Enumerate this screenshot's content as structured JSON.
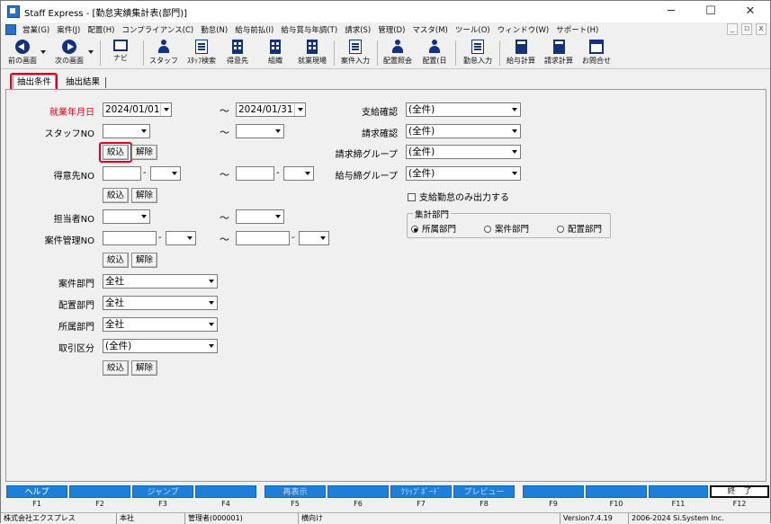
{
  "window": {
    "title": "Staff Express - [勤怠実績集計表(部門)]",
    "controls": {
      "minimize": "─",
      "maximize": "☐",
      "close": "✕"
    }
  },
  "menu": {
    "items": [
      "営業(G)",
      "案件(J)",
      "配置(H)",
      "コンプライアンス(C)",
      "勤怠(N)",
      "給与前払(I)",
      "給与賞与年調(T)",
      "請求(S)",
      "管理(D)",
      "マスタ(M)",
      "ツール(O)",
      "ウィンドウ(W)",
      "サポート(H)"
    ],
    "mdi_controls": [
      "_",
      "▫",
      "x"
    ]
  },
  "toolbar": {
    "back": "前の画面",
    "next": "次の画面",
    "navi": "ナビ",
    "staff": "スタッフ",
    "staff_search": "ｽﾀｯﾌ検索",
    "tokuisaki": "得意先",
    "soshiki": "組織",
    "shugyo_genba": "就業現場",
    "anken_nyuryoku": "案件入力",
    "haichi_shokai": "配置照会",
    "haichi_hi": "配置(日",
    "kintai_nyuryoku": "勤怠入力",
    "kyuyo_keisan": "給与計算",
    "seikyu_keisan": "請求計算",
    "otoiawase": "お問合せ"
  },
  "tabs": {
    "conditions": "抽出条件",
    "results": "抽出結果"
  },
  "form": {
    "work_ym_label": "就業年月日",
    "date_from": "2024/01/01",
    "date_to": "2024/01/31",
    "tilde": "～",
    "staff_no_label": "スタッフNO",
    "tokuisaki_no_label": "得意先NO",
    "tanto_no_label": "担当者NO",
    "anken_kanri_no_label": "案件管理NO",
    "dash": "-",
    "filter_button": "絞込",
    "clear_button": "解除",
    "anken_bumon_label": "案件部門",
    "anken_bumon_value": "全社",
    "haichi_bumon_label": "配置部門",
    "haichi_bumon_value": "全社",
    "shozoku_bumon_label": "所属部門",
    "shozoku_bumon_value": "全社",
    "torihiki_kubun_label": "取引区分",
    "torihiki_kubun_value": "(全件)",
    "shikyu_kakunin_label": "支給確認",
    "shikyu_kakunin_value": "(全件)",
    "seikyu_kakunin_label": "請求確認",
    "seikyu_kakunin_value": "(全件)",
    "seikyu_shime_label": "請求締グループ",
    "seikyu_shime_value": "(全件)",
    "kyuyo_shime_label": "給与締グループ",
    "kyuyo_shime_value": "(全件)",
    "shikyu_only_label": "支給勤怠のみ出力する",
    "shukei_bumon_title": "集計部門",
    "radio_shozoku": "所属部門",
    "radio_anken": "案件部門",
    "radio_haichi": "配置部門"
  },
  "fkeys": [
    {
      "label": "ヘルプ",
      "code": "F1",
      "enabled": true
    },
    {
      "label": "",
      "code": "F2",
      "enabled": true
    },
    {
      "label": "ジャンプ",
      "code": "F3",
      "enabled": false
    },
    {
      "label": "",
      "code": "F4",
      "enabled": true
    },
    {
      "label": "再表示",
      "code": "F5",
      "enabled": false
    },
    {
      "label": "",
      "code": "F6",
      "enabled": true
    },
    {
      "label": "ｸﾘｯﾌﾟﾎﾞｰﾄﾞ",
      "code": "F7",
      "enabled": false
    },
    {
      "label": "プレビュー",
      "code": "F8",
      "enabled": false
    },
    {
      "label": "",
      "code": "F9",
      "enabled": true
    },
    {
      "label": "",
      "code": "F10",
      "enabled": true
    },
    {
      "label": "",
      "code": "F11",
      "enabled": true
    },
    {
      "label": "終　了",
      "code": "F12",
      "enabled": true
    }
  ],
  "status": {
    "company": "株式会社エクスプレス",
    "branch": "本社",
    "user": "管理者(000001)",
    "mode": "横向け",
    "version": "Version7.4.19",
    "copyright": "2006-2024 Si.System Inc."
  },
  "colors": {
    "accent_red": "#e3001b",
    "fkey_blue": "#1f7fd8",
    "icon_navy": "#14317a"
  }
}
